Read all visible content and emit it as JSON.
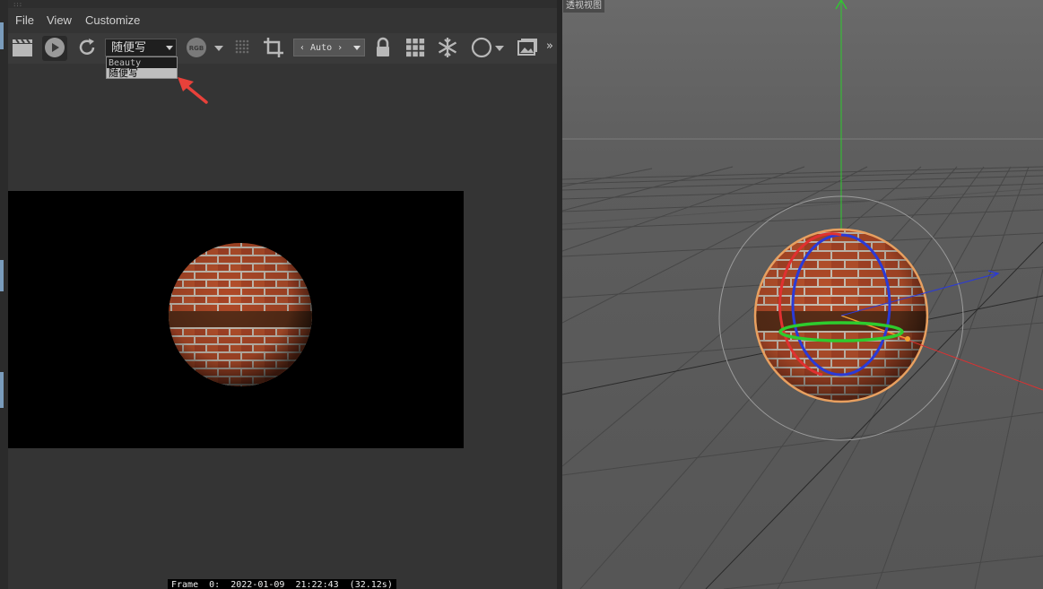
{
  "menubar": {
    "items": [
      "File",
      "View",
      "Customize"
    ]
  },
  "toolbar": {
    "icons": [
      "clapper-icon",
      "play-icon",
      "refresh-icon",
      "rgb-icon",
      "grid-dots-icon",
      "crop-icon",
      "lock-icon",
      "grid-icon",
      "snowflake-icon",
      "circle-icon",
      "image-icon",
      "more-icon"
    ],
    "rgb_label": "RGB",
    "pass_select_value": "随便写",
    "zoom_select_value": "‹ Auto ›",
    "overflow_label": "»"
  },
  "pass_dropdown": {
    "options": [
      "Beauty",
      "随便写"
    ],
    "highlighted_index": 1
  },
  "status_bar": {
    "text": "Frame  0:  2022-01-09  21:22:43  (32.12s)"
  },
  "viewport": {
    "title": "透视视图"
  },
  "colors": {
    "annotation_arrow": "#e8413a",
    "axis_y": "#2ecc2e",
    "axis_x": "#e03030",
    "axis_z": "#2a3ad8",
    "brick": "#b04a28",
    "mortar": "#c9c0b4",
    "band": "#5a2e18",
    "selection_outline": "#e8a060"
  }
}
